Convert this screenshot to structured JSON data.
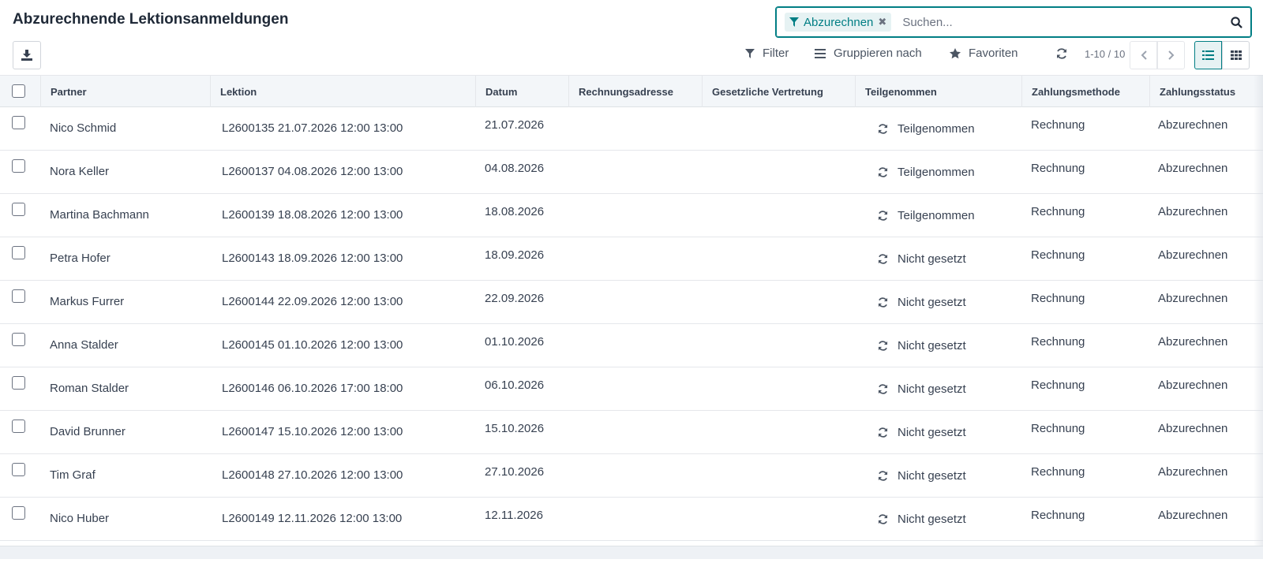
{
  "header": {
    "title": "Abzurechnende Lektionsanmeldungen"
  },
  "search": {
    "facet": "Abzurechnen",
    "placeholder": "Suchen..."
  },
  "toolbar": {
    "filter_label": "Filter",
    "group_label": "Gruppieren nach",
    "favorites_label": "Favoriten",
    "pager": "1-10 / 10"
  },
  "columns": [
    "Partner",
    "Lektion",
    "Datum",
    "Rechnungsadresse",
    "Gesetzliche Vertretung",
    "Teilgenommen",
    "Zahlungsmethode",
    "Zahlungsstatus"
  ],
  "rows": [
    {
      "partner": "Nico Schmid",
      "lektion": "L2600135 21.07.2026 12:00 13:00",
      "datum": "21.07.2026",
      "teilgenommen": "Teilgenommen",
      "methode": "Rechnung",
      "status": "Abzurechnen"
    },
    {
      "partner": "Nora Keller",
      "lektion": "L2600137 04.08.2026 12:00 13:00",
      "datum": "04.08.2026",
      "teilgenommen": "Teilgenommen",
      "methode": "Rechnung",
      "status": "Abzurechnen"
    },
    {
      "partner": "Martina Bachmann",
      "lektion": "L2600139 18.08.2026 12:00 13:00",
      "datum": "18.08.2026",
      "teilgenommen": "Teilgenommen",
      "methode": "Rechnung",
      "status": "Abzurechnen"
    },
    {
      "partner": "Petra Hofer",
      "lektion": "L2600143 18.09.2026 12:00 13:00",
      "datum": "18.09.2026",
      "teilgenommen": "Nicht gesetzt",
      "methode": "Rechnung",
      "status": "Abzurechnen"
    },
    {
      "partner": "Markus Furrer",
      "lektion": "L2600144 22.09.2026 12:00 13:00",
      "datum": "22.09.2026",
      "teilgenommen": "Nicht gesetzt",
      "methode": "Rechnung",
      "status": "Abzurechnen"
    },
    {
      "partner": "Anna Stalder",
      "lektion": "L2600145 01.10.2026 12:00 13:00",
      "datum": "01.10.2026",
      "teilgenommen": "Nicht gesetzt",
      "methode": "Rechnung",
      "status": "Abzurechnen"
    },
    {
      "partner": "Roman Stalder",
      "lektion": "L2600146 06.10.2026 17:00 18:00",
      "datum": "06.10.2026",
      "teilgenommen": "Nicht gesetzt",
      "methode": "Rechnung",
      "status": "Abzurechnen"
    },
    {
      "partner": "David Brunner",
      "lektion": "L2600147 15.10.2026 12:00 13:00",
      "datum": "15.10.2026",
      "teilgenommen": "Nicht gesetzt",
      "methode": "Rechnung",
      "status": "Abzurechnen"
    },
    {
      "partner": "Tim Graf",
      "lektion": "L2600148 27.10.2026 12:00 13:00",
      "datum": "27.10.2026",
      "teilgenommen": "Nicht gesetzt",
      "methode": "Rechnung",
      "status": "Abzurechnen"
    },
    {
      "partner": "Nico Huber",
      "lektion": "L2600149 12.11.2026 12:00 13:00",
      "datum": "12.11.2026",
      "teilgenommen": "Nicht gesetzt",
      "methode": "Rechnung",
      "status": "Abzurechnen"
    }
  ],
  "colors": {
    "accent": "#017e84"
  }
}
